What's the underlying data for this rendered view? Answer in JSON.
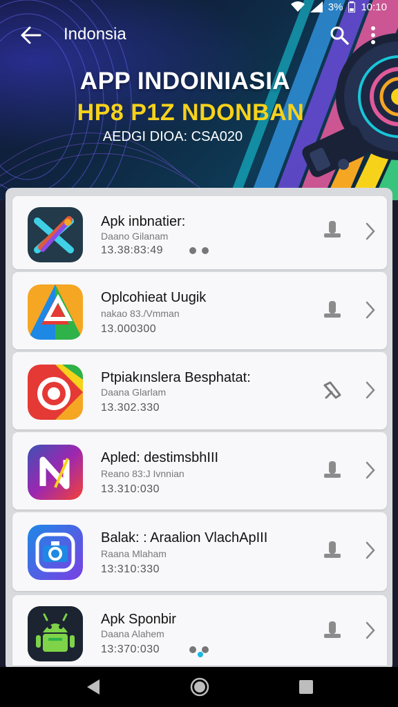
{
  "status_bar": {
    "battery": "3%",
    "time": "10:10"
  },
  "app_bar": {
    "title": "Indonsia"
  },
  "hero": {
    "title": "APP INDOINIASIA",
    "subtitle": "HP8 P1Z NDONBAN",
    "caption": "AEDGI DIOA: CSA020"
  },
  "apps": [
    {
      "name": "Apk inbnatier:",
      "subtitle": "Daano Gilanam",
      "size": "13.38:83:49",
      "icon": "cross-arrow-app-icon",
      "action": "download-icon"
    },
    {
      "name": "Oplcohieat Uugik",
      "subtitle": "nakao 83./Vmman",
      "size": "13.000300",
      "icon": "triangle-app-icon",
      "action": "download-icon"
    },
    {
      "name": "Ptpiakınslera Besphatat:",
      "subtitle": "Daana Glarlam",
      "size": "13.302.330",
      "icon": "camera-lens-app-icon",
      "action": "edit-icon"
    },
    {
      "name": "Apled: destimsbhIII",
      "subtitle": "Reano 83:J Ivnnian",
      "size": "13.310:030",
      "icon": "letter-n-app-icon",
      "action": "download-icon"
    },
    {
      "name": "Balak: : Araalion VlachApIII",
      "subtitle": "Raana Mlaham",
      "size": "13:310:330",
      "icon": "camera-app-icon",
      "action": "download-icon"
    },
    {
      "name": "Apk Sponbir",
      "subtitle": "Daana Alahem",
      "size": "13:370:030",
      "icon": "android-robot-app-icon",
      "action": "download-icon"
    }
  ],
  "colors": {
    "accent_yellow": "#f7d21b",
    "card_bg": "#f8f8fa",
    "list_bg": "#d9dade"
  }
}
